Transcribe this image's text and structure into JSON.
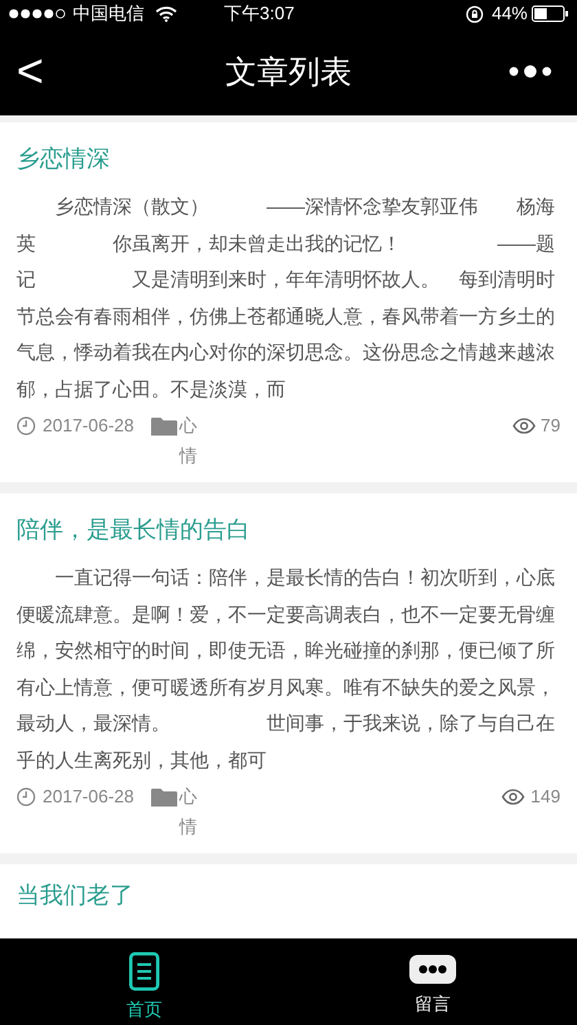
{
  "status_bar": {
    "carrier": "中国电信",
    "time": "下午3:07",
    "battery": "44%"
  },
  "nav": {
    "back": "<",
    "title": "文章列表"
  },
  "articles": [
    {
      "title": "乡恋情深",
      "excerpt": "乡恋情深（散文）　　　——深情怀念挚友郭亚伟　　杨海英　　　　你虽离开，却未曾走出我的记忆！　　　　　——题记　　　　　又是清明到来时，年年清明怀故人。　每到清明时节总会有春雨相伴，仿佛上苍都通晓人意，春风带着一方乡土的气息，悸动着我在内心对你的深切思念。这份思念之情越来越浓郁，占据了心田。不是淡漠，而",
      "date": "2017-06-28",
      "category": "心情",
      "views": "79"
    },
    {
      "title": "陪伴，是最长情的告白",
      "excerpt": "一直记得一句话：陪伴，是最长情的告白！初次听到，心底便暖流肆意。是啊！爱，不一定要高调表白，也不一定要无骨缠绵，安然相守的时间，即使无语，眸光碰撞的刹那，便已倾了所有心上情意，便可暖透所有岁月风寒。唯有不缺失的爱之风景，最动人，最深情。　　　　　世间事，于我来说，除了与自己在乎的人生离死别，其他，都可",
      "date": "2017-06-28",
      "category": "心情",
      "views": "149"
    },
    {
      "title": "当我们老了"
    }
  ],
  "tabs": [
    {
      "label": "首页",
      "kind": "list",
      "selected": true
    },
    {
      "label": "留言",
      "kind": "chat",
      "selected": false
    }
  ]
}
